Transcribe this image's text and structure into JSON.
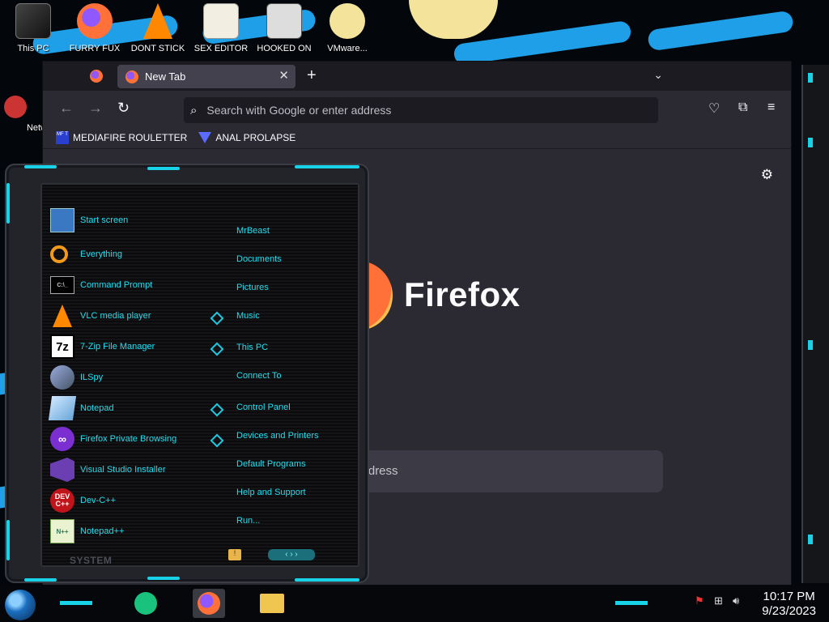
{
  "desktop": {
    "icons": [
      {
        "label": "This PC"
      },
      {
        "label": "FURRY FUX"
      },
      {
        "label": "DONT STICK"
      },
      {
        "label": "SEX EDITOR"
      },
      {
        "label": "HOOKED ON"
      },
      {
        "label": "VMware..."
      }
    ],
    "left_partial_icon_label": "Netw"
  },
  "browser": {
    "tab_title": "New Tab",
    "new_tab_symbol": "+",
    "address_placeholder": "Search with Google or enter address",
    "bookmarks": [
      {
        "label": "MEDIAFIRE ROULETTER",
        "icon_text": "MF T"
      },
      {
        "label": "ANAL PROLAPSE"
      }
    ],
    "brand_name": "Firefox",
    "content_search_placeholder": "r address"
  },
  "start_menu": {
    "apps": [
      {
        "label": "Start screen",
        "icon": "start-screen-icon"
      },
      {
        "label": "Everything",
        "icon": "magnifier-icon"
      },
      {
        "label": "Command Prompt",
        "icon": "command-prompt-icon"
      },
      {
        "label": "VLC media player",
        "icon": "vlc-cone-icon"
      },
      {
        "label": "7-Zip File Manager",
        "icon": "seven-zip-icon"
      },
      {
        "label": "ILSpy",
        "icon": "ilspy-icon"
      },
      {
        "label": "Notepad",
        "icon": "notepad-icon"
      },
      {
        "label": "Firefox Private Browsing",
        "icon": "private-browsing-icon"
      },
      {
        "label": "Visual Studio Installer",
        "icon": "visual-studio-installer-icon"
      },
      {
        "label": "Dev-C++",
        "icon": "devcpp-icon"
      },
      {
        "label": "Notepad++",
        "icon": "notepadpp-icon"
      }
    ],
    "places": [
      {
        "label": "MrBeast"
      },
      {
        "label": "Documents"
      },
      {
        "label": "Pictures"
      },
      {
        "label": "Music"
      },
      {
        "label": "This PC"
      },
      {
        "label": "Connect To"
      },
      {
        "label": "Control Panel"
      },
      {
        "label": "Devices and Printers"
      },
      {
        "label": "Default Programs"
      },
      {
        "label": "Help and Support"
      },
      {
        "label": "Run..."
      }
    ],
    "system_label": "SYSTEM"
  },
  "taskbar": {
    "time": "10:17 PM",
    "date": "9/23/2023"
  },
  "colors": {
    "accent_cyan": "#18d3e8",
    "menu_text": "#1ee0f0",
    "browser_bg": "#2b2a33",
    "urlbar_bg": "#1c1b22"
  }
}
